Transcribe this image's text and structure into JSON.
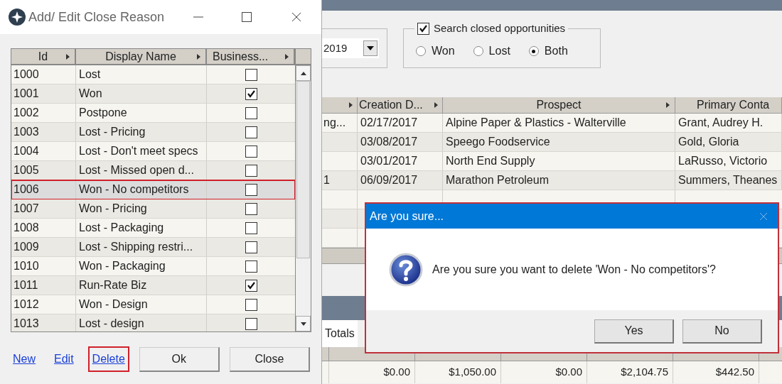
{
  "main_window": {
    "date_field": {
      "value": "2019"
    },
    "closed_filter": {
      "label": "Search closed opportunities",
      "checked": true,
      "options": [
        {
          "label": "Won",
          "selected": false
        },
        {
          "label": "Lost",
          "selected": false
        },
        {
          "label": "Both",
          "selected": true
        }
      ]
    },
    "opportunities_table": {
      "columns": [
        "Creation D...",
        "Prospect",
        "Primary Conta"
      ],
      "rows": [
        {
          "column_1": "ng...",
          "cells": [
            "02/17/2017",
            "Alpine Paper & Plastics - Walterville",
            "Grant, Audrey H."
          ]
        },
        {
          "cells": [
            "03/08/2017",
            "Speego Foodservice",
            "Gold, Gloria"
          ]
        },
        {
          "cells": [
            "03/01/2017",
            "North End Supply",
            "LaRusso, Victorio"
          ]
        },
        {
          "column_1": "1",
          "cells": [
            "06/09/2017",
            "Marathon Petroleum",
            "Summers, Theanes"
          ]
        }
      ]
    },
    "totals_tab": "Totals",
    "totals_row": [
      "$0.00",
      "$1,050.00",
      "$0.00",
      "$2,104.75",
      "$442.50"
    ]
  },
  "dialog": {
    "title": "Add/ Edit Close Reason",
    "columns": [
      "Id",
      "Display Name",
      "Business..."
    ],
    "rows": [
      {
        "id": "1000",
        "name": "Lost",
        "checked": false,
        "selected": false,
        "annotated": false
      },
      {
        "id": "1001",
        "name": "Won",
        "checked": true,
        "selected": false,
        "annotated": false
      },
      {
        "id": "1002",
        "name": "Postpone",
        "checked": false,
        "selected": false,
        "annotated": false
      },
      {
        "id": "1003",
        "name": "Lost - Pricing",
        "checked": false,
        "selected": false,
        "annotated": false
      },
      {
        "id": "1004",
        "name": "Lost - Don't meet specs",
        "checked": false,
        "selected": false,
        "annotated": false
      },
      {
        "id": "1005",
        "name": "Lost - Missed open d...",
        "checked": false,
        "selected": false,
        "annotated": false
      },
      {
        "id": "1006",
        "name": "Won - No competitors",
        "checked": false,
        "selected": true,
        "annotated": true
      },
      {
        "id": "1007",
        "name": "Won - Pricing",
        "checked": false,
        "selected": false,
        "annotated": false
      },
      {
        "id": "1008",
        "name": "Lost - Packaging",
        "checked": false,
        "selected": false,
        "annotated": false
      },
      {
        "id": "1009",
        "name": "Lost - Shipping restri...",
        "checked": false,
        "selected": false,
        "annotated": false
      },
      {
        "id": "1010",
        "name": "Won - Packaging",
        "checked": false,
        "selected": false,
        "annotated": false
      },
      {
        "id": "1011",
        "name": "Run-Rate Biz",
        "checked": true,
        "selected": false,
        "annotated": false
      },
      {
        "id": "1012",
        "name": "Won - Design",
        "checked": false,
        "selected": false,
        "annotated": false
      },
      {
        "id": "1013",
        "name": "Lost - design",
        "checked": false,
        "selected": false,
        "annotated": false
      }
    ],
    "links": [
      {
        "label": "New",
        "annotated": false
      },
      {
        "label": "Edit",
        "annotated": false
      },
      {
        "label": "Delete",
        "annotated": true
      }
    ],
    "buttons": [
      "Ok",
      "Close"
    ]
  },
  "message_box": {
    "title": "Are you sure...",
    "message": "Are you sure you want to delete 'Won - No competitors'?",
    "buttons": [
      "Yes",
      "No"
    ]
  }
}
